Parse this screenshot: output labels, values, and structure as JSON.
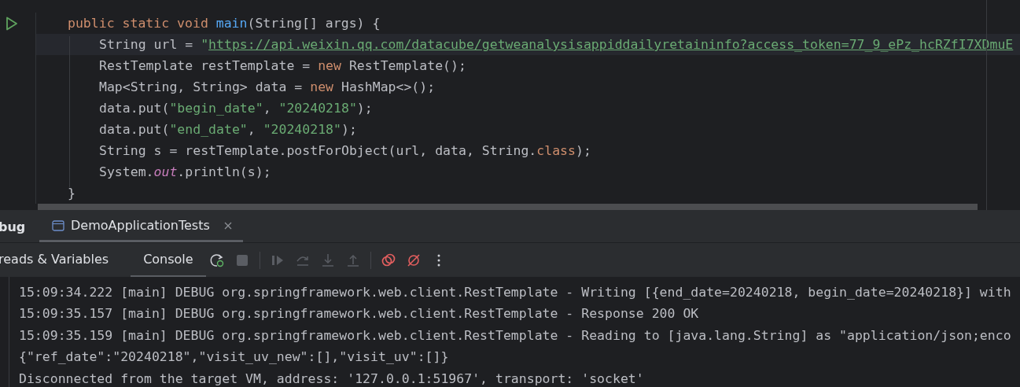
{
  "editor": {
    "lines": [
      {
        "current": false,
        "run": true,
        "tokens": [
          {
            "kind": "kw",
            "text": "public static void "
          },
          {
            "kind": "fn",
            "text": "main"
          },
          {
            "kind": "plain",
            "text": "(String[] args) {"
          }
        ],
        "children": [
          {
            "current": true,
            "tokens": [
              {
                "kind": "plain",
                "text": "String url = "
              },
              {
                "kind": "str",
                "text": "\""
              },
              {
                "kind": "link",
                "text": "https://api.weixin.qq.com/datacube/getweanalysisappiddailyretaininfo?access_token=77_9_ePz_hcRZfI7XDmuE"
              }
            ]
          },
          {
            "current": false,
            "tokens": [
              {
                "kind": "plain",
                "text": "RestTemplate restTemplate = "
              },
              {
                "kind": "kw",
                "text": "new"
              },
              {
                "kind": "plain",
                "text": " RestTemplate();"
              }
            ]
          },
          {
            "current": false,
            "tokens": [
              {
                "kind": "plain",
                "text": "Map<String, String> data = "
              },
              {
                "kind": "kw",
                "text": "new"
              },
              {
                "kind": "plain",
                "text": " HashMap<>();"
              }
            ]
          },
          {
            "current": false,
            "tokens": [
              {
                "kind": "plain",
                "text": "data.put("
              },
              {
                "kind": "str",
                "text": "\"begin_date\""
              },
              {
                "kind": "plain",
                "text": ", "
              },
              {
                "kind": "str",
                "text": "\"20240218\""
              },
              {
                "kind": "plain",
                "text": ");"
              }
            ]
          },
          {
            "current": false,
            "tokens": [
              {
                "kind": "plain",
                "text": "data.put("
              },
              {
                "kind": "str",
                "text": "\"end_date\""
              },
              {
                "kind": "plain",
                "text": ", "
              },
              {
                "kind": "str",
                "text": "\"20240218\""
              },
              {
                "kind": "plain",
                "text": ");"
              }
            ]
          },
          {
            "current": false,
            "tokens": [
              {
                "kind": "plain",
                "text": "String s = restTemplate.postForObject(url, data, String."
              },
              {
                "kind": "kw",
                "text": "class"
              },
              {
                "kind": "plain",
                "text": ");"
              }
            ]
          },
          {
            "current": false,
            "tokens": [
              {
                "kind": "plain",
                "text": "System."
              },
              {
                "kind": "static",
                "text": "out"
              },
              {
                "kind": "plain",
                "text": ".println(s);"
              }
            ]
          }
        ]
      },
      {
        "current": false,
        "tokens": [
          {
            "kind": "plain",
            "text": "}"
          }
        ]
      }
    ]
  },
  "tool_window_title": "bug",
  "session_tabs": [
    {
      "label": "DemoApplicationTests",
      "selected": true
    }
  ],
  "subtabs": [
    {
      "label": "reads & Variables",
      "selected": false
    },
    {
      "label": "Console",
      "selected": true
    }
  ],
  "toolbar": [
    {
      "kind": "rerun",
      "disabled": false
    },
    {
      "kind": "stop",
      "disabled": true
    },
    {
      "kind": "separator"
    },
    {
      "kind": "resume",
      "disabled": true
    },
    {
      "kind": "step-over",
      "disabled": true
    },
    {
      "kind": "step-into",
      "disabled": true
    },
    {
      "kind": "step-out",
      "disabled": true
    },
    {
      "kind": "separator"
    },
    {
      "kind": "breakpoints",
      "disabled": false
    },
    {
      "kind": "mute",
      "disabled": false
    },
    {
      "kind": "more",
      "disabled": false
    }
  ],
  "console_lines": [
    "15:09:34.222 [main] DEBUG org.springframework.web.client.RestTemplate - Writing [{end_date=20240218, begin_date=20240218}] with",
    "15:09:35.157 [main] DEBUG org.springframework.web.client.RestTemplate - Response 200 OK",
    "15:09:35.159 [main] DEBUG org.springframework.web.client.RestTemplate - Reading to [java.lang.String] as \"application/json;enco",
    "{\"ref_date\":\"20240218\",\"visit_uv_new\":[],\"visit_uv\":[]}",
    "Disconnected from the target VM, address: '127.0.0.1:51967', transport: 'socket'"
  ]
}
